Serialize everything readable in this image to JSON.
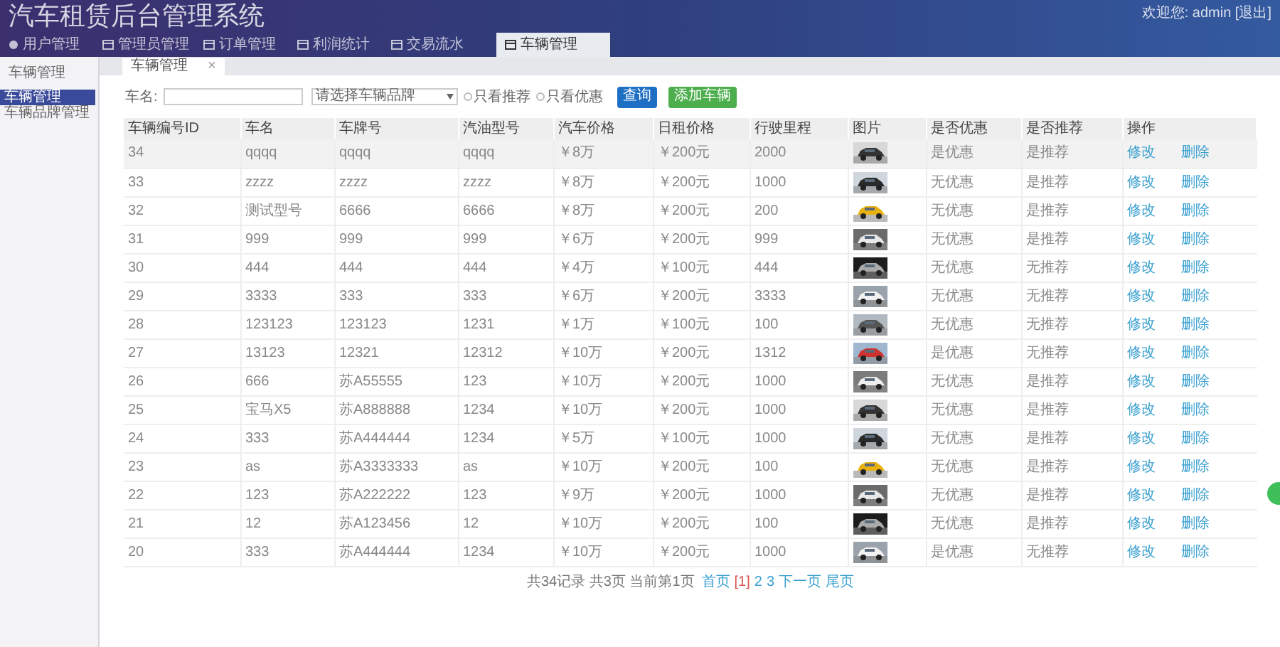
{
  "header": {
    "title": "汽车租赁后台管理系统",
    "user_info": "欢迎您: admin [退出]"
  },
  "nav_tabs": [
    {
      "label": "用户管理",
      "selected": false
    },
    {
      "label": "管理员管理",
      "selected": false
    },
    {
      "label": "订单管理",
      "selected": false
    },
    {
      "label": "利润统计",
      "selected": false
    },
    {
      "label": "交易流水",
      "selected": false
    },
    {
      "label": "车辆管理",
      "selected": true
    }
  ],
  "sidebar": {
    "title": "车辆管理",
    "items": [
      {
        "label": "车辆管理",
        "selected": true
      },
      {
        "label": "车辆品牌管理",
        "selected": false
      }
    ]
  },
  "page_tab": {
    "label": "车辆管理",
    "close": "×"
  },
  "filter": {
    "name_label": "车名:",
    "brand_select": "请选择车辆品牌",
    "options": [
      {
        "label": "只看推荐",
        "checked": false
      },
      {
        "label": "只看优惠",
        "checked": false
      }
    ],
    "search_button": "查询",
    "add_button": "添加车辆"
  },
  "table": {
    "columns": [
      "车辆编号ID",
      "车名",
      "车牌号",
      "汽油型号",
      "汽车价格",
      "日租价格",
      "行驶里程",
      "图片",
      "是否优惠",
      "是否推荐",
      "操作"
    ],
    "rows": [
      {
        "cells": [
          "34",
          "qqqq",
          "qqqq",
          "qqqq",
          "￥8万",
          "￥200元",
          "2000"
        ],
        "discount": "是优惠",
        "recommend": "是推荐",
        "selected": true
      },
      {
        "cells": [
          "33",
          "zzzz",
          "zzzz",
          "zzzz",
          "￥8万",
          "￥200元",
          "1000"
        ],
        "discount": "无优惠",
        "recommend": "是推荐",
        "selected": false
      },
      {
        "cells": [
          "32",
          "测试型号",
          "6666",
          "6666",
          "￥8万",
          "￥200元",
          "200"
        ],
        "discount": "无优惠",
        "recommend": "是推荐",
        "selected": false
      },
      {
        "cells": [
          "31",
          "999",
          "999",
          "999",
          "￥6万",
          "￥200元",
          "999"
        ],
        "discount": "无优惠",
        "recommend": "是推荐",
        "selected": false
      },
      {
        "cells": [
          "30",
          "444",
          "444",
          "444",
          "￥4万",
          "￥100元",
          "444"
        ],
        "discount": "无优惠",
        "recommend": "无推荐",
        "selected": false
      },
      {
        "cells": [
          "29",
          "3333",
          "333",
          "333",
          "￥6万",
          "￥200元",
          "3333"
        ],
        "discount": "无优惠",
        "recommend": "无推荐",
        "selected": false
      },
      {
        "cells": [
          "28",
          "123123",
          "123123",
          "1231",
          "￥1万",
          "￥100元",
          "100"
        ],
        "discount": "无优惠",
        "recommend": "无推荐",
        "selected": false
      },
      {
        "cells": [
          "27",
          "13123",
          "12321",
          "12312",
          "￥10万",
          "￥200元",
          "1312"
        ],
        "discount": "是优惠",
        "recommend": "无推荐",
        "selected": false
      },
      {
        "cells": [
          "26",
          "666",
          "苏A55555",
          "123",
          "￥10万",
          "￥200元",
          "1000"
        ],
        "discount": "无优惠",
        "recommend": "是推荐",
        "selected": false
      },
      {
        "cells": [
          "25",
          "宝马X5",
          "苏A888888",
          "1234",
          "￥10万",
          "￥200元",
          "1000"
        ],
        "discount": "无优惠",
        "recommend": "是推荐",
        "selected": false
      },
      {
        "cells": [
          "24",
          "333",
          "苏A444444",
          "1234",
          "￥5万",
          "￥100元",
          "1000"
        ],
        "discount": "无优惠",
        "recommend": "是推荐",
        "selected": false
      },
      {
        "cells": [
          "23",
          "as",
          "苏A3333333",
          "as",
          "￥10万",
          "￥200元",
          "100"
        ],
        "discount": "无优惠",
        "recommend": "是推荐",
        "selected": false
      },
      {
        "cells": [
          "22",
          "123",
          "苏A222222",
          "123",
          "￥9万",
          "￥200元",
          "1000"
        ],
        "discount": "无优惠",
        "recommend": "是推荐",
        "selected": false
      },
      {
        "cells": [
          "21",
          "12",
          "苏A123456",
          "12",
          "￥10万",
          "￥200元",
          "100"
        ],
        "discount": "无优惠",
        "recommend": "是推荐",
        "selected": false
      },
      {
        "cells": [
          "20",
          "333",
          "苏A444444",
          "1234",
          "￥10万",
          "￥200元",
          "1000"
        ],
        "discount": "是优惠",
        "recommend": "无推荐",
        "selected": false
      }
    ],
    "row_actions": [
      [
        "修改",
        "删除"
      ],
      [
        "修改",
        "删除"
      ],
      [
        "修改",
        "删除"
      ],
      [
        "修改",
        "删除"
      ],
      [
        "修改",
        "删除"
      ],
      [
        "修改",
        "删除"
      ],
      [
        "修改",
        "删除"
      ],
      [
        "修改",
        "删除"
      ],
      [
        "修改",
        "删除"
      ],
      [
        "修改",
        "删除"
      ],
      [
        "修改",
        "删除"
      ],
      [
        "修改",
        "删除"
      ],
      [
        "修改",
        "删除"
      ],
      [
        "修改",
        "删除"
      ],
      [
        "修改",
        "删除"
      ]
    ]
  },
  "pagination": {
    "summary": "共34记录 共3页 当前第1页",
    "links": [
      {
        "label": "首页",
        "selected": false
      },
      {
        "label": "[1]",
        "selected": true
      },
      {
        "label": "2",
        "selected": false
      },
      {
        "label": "3",
        "selected": false
      },
      {
        "label": "下一页",
        "selected": false
      },
      {
        "label": "尾页",
        "selected": false
      }
    ]
  }
}
